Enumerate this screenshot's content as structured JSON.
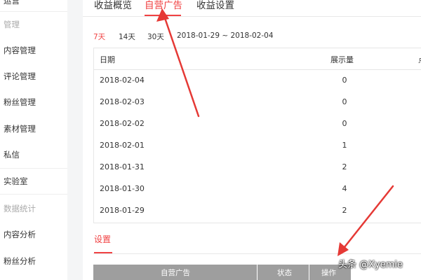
{
  "sidebar": {
    "cut_label": "运营",
    "items": [
      {
        "label": "管理",
        "muted": true
      },
      {
        "label": "内容管理",
        "muted": false
      },
      {
        "label": "评论管理",
        "muted": false
      },
      {
        "label": "粉丝管理",
        "muted": false
      },
      {
        "label": "素材管理",
        "muted": false
      },
      {
        "label": "私信",
        "muted": false
      },
      {
        "label": "实验室",
        "muted": false
      },
      {
        "label": "数据统计",
        "muted": true
      },
      {
        "label": "内容分析",
        "muted": false
      },
      {
        "label": "粉丝分析",
        "muted": false
      }
    ]
  },
  "tabs": [
    {
      "label": "收益概览",
      "active": false
    },
    {
      "label": "自营广告",
      "active": true
    },
    {
      "label": "收益设置",
      "active": false
    }
  ],
  "date_filter": {
    "ranges": [
      "7天",
      "14天",
      "30天"
    ],
    "active": "7天",
    "date_range": "2018-01-29 ~ 2018-02-04"
  },
  "table": {
    "columns": [
      "日期",
      "展示量",
      "点"
    ],
    "rows": [
      {
        "date": "2018-02-04",
        "views": "0"
      },
      {
        "date": "2018-02-03",
        "views": "0"
      },
      {
        "date": "2018-02-02",
        "views": "0"
      },
      {
        "date": "2018-02-01",
        "views": "1"
      },
      {
        "date": "2018-01-31",
        "views": "2"
      },
      {
        "date": "2018-01-30",
        "views": "4"
      },
      {
        "date": "2018-01-29",
        "views": "2"
      }
    ]
  },
  "settings": {
    "tab_label": "设置",
    "columns": [
      "自营广告",
      "状态",
      "操作"
    ]
  },
  "watermark": "头条 @Xyemie",
  "colors": {
    "accent": "#f04142",
    "arrow": "#e53935",
    "table_header_bg": "#9e9e9e"
  }
}
